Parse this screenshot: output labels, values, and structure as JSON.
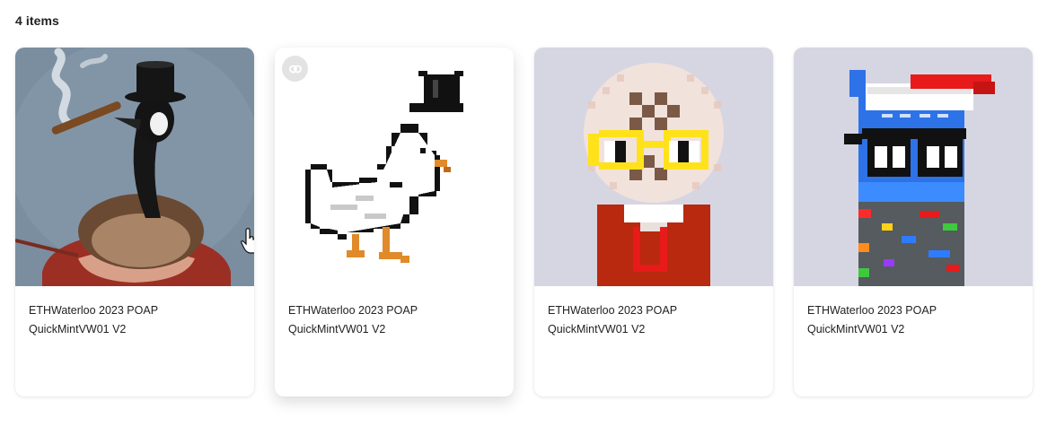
{
  "collection": {
    "item_count_label": "4 items"
  },
  "cards": [
    {
      "title": "ETHWaterloo 2023 POAP",
      "subtitle": "QuickMintVW01 V2",
      "image_icon": "goose-with-top-hat-and-cigar-image"
    },
    {
      "title": "ETHWaterloo 2023 POAP",
      "subtitle": "QuickMintVW01 V2",
      "image_icon": "pixel-goose-with-top-hat-image",
      "badge_icon": "link-icon"
    },
    {
      "title": "ETHWaterloo 2023 POAP",
      "subtitle": "QuickMintVW01 V2",
      "image_icon": "pixel-character-with-yellow-glasses-image"
    },
    {
      "title": "ETHWaterloo 2023 POAP",
      "subtitle": "QuickMintVW01 V2",
      "image_icon": "pixel-character-with-cap-and-sunglasses-image"
    }
  ],
  "colors": {
    "card_background": "#ffffff",
    "thumb_blue_gray": "#7a8ea0",
    "thumb_lavender": "#d6d6e2",
    "text": "#222222"
  }
}
